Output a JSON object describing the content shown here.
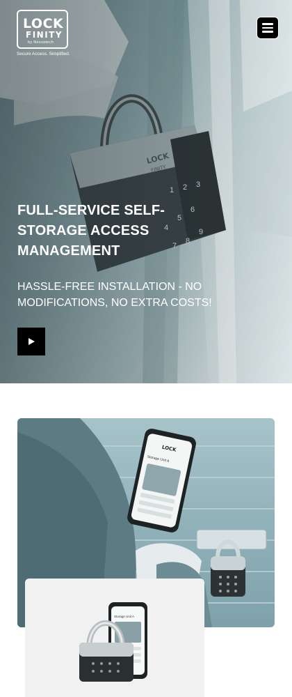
{
  "brand": {
    "name_line1": "LOCK",
    "name_line2": "FINITY",
    "byline": "by Nexustech",
    "tagline": "Secure Access. Simplified."
  },
  "nav": {
    "menu_icon": "hamburger-menu-icon"
  },
  "hero": {
    "title": "FULL-SERVICE SELF-STORAGE ACCESS MANAGEMENT",
    "subtitle": "HASSLE-FREE INSTALLATION - NO MODIFICATIONS, NO EXTRA COSTS!",
    "play_icon": "play-icon",
    "keypad_digits": [
      "1",
      "2",
      "3",
      "4",
      "5",
      "6",
      "7",
      "8",
      "9"
    ]
  },
  "feature": {
    "phone_brand": "LOCK",
    "phone_unit_label": "Storage Unit A",
    "card_phone_label": "Storage Unit A"
  },
  "colors": {
    "accent": "#000000",
    "text_on_hero": "#ffffff",
    "background": "#ffffff",
    "photo_tint": "#8fb0b8"
  }
}
